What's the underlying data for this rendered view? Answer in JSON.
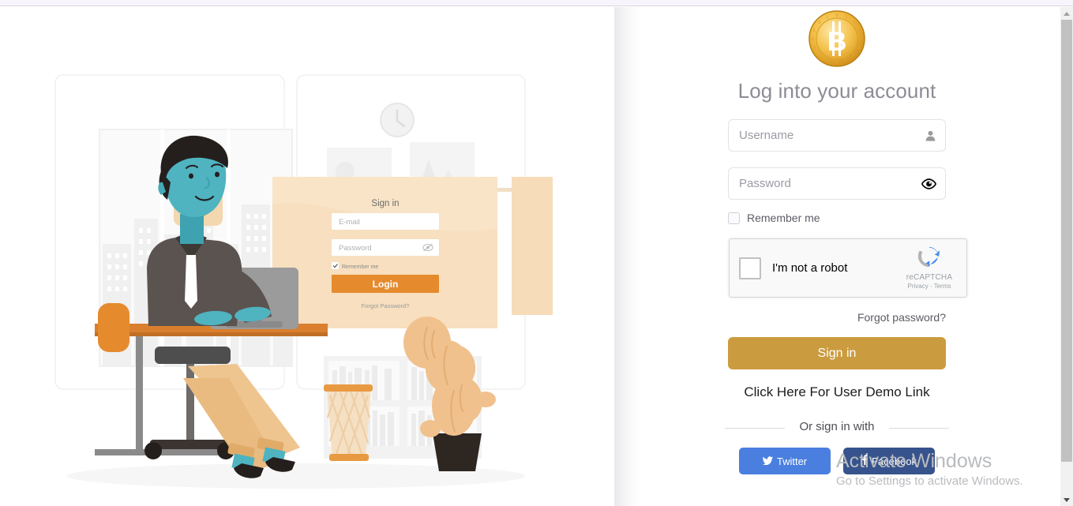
{
  "page": {
    "title": "Log into your account",
    "logo_icon": "bitcoin-coin-icon",
    "logo_symbol": "Ƀ"
  },
  "form": {
    "username": {
      "value": "",
      "placeholder": "Username",
      "icon": "user-icon"
    },
    "password": {
      "value": "",
      "placeholder": "Password",
      "icon": "eye-icon"
    },
    "remember_me_label": "Remember me",
    "remember_me_checked": false,
    "forgot_password_label": "Forgot password?",
    "signin_label": "Sign in",
    "demo_link_label": "Click Here For User Demo Link",
    "or_divider_label": "Or sign in with"
  },
  "recaptcha": {
    "label": "I'm not a robot",
    "brand": "reCAPTCHA",
    "legal": "Privacy - Terms",
    "checked": false,
    "icon": "recaptcha-icon"
  },
  "social": [
    {
      "label": "Twitter",
      "icon": "twitter-icon",
      "color": "#4a7fe0",
      "name": "twitter-button"
    },
    {
      "label": "Facebook",
      "icon": "facebook-icon",
      "color": "#37538d",
      "name": "facebook-button"
    }
  ],
  "illustration": {
    "alt_name": "login-illustration",
    "mock_form": {
      "heading": "Sign in",
      "email_placeholder": "E-mail",
      "password_placeholder": "Password",
      "remember_label": "Remember me",
      "login_button": "Login",
      "forgot_label": "Forgot Password?"
    }
  },
  "watermark": {
    "title": "Activate Windows",
    "subtitle": "Go to Settings to activate Windows."
  },
  "colors": {
    "accent_gold": "#cb9c3f",
    "illustration_orange": "#e58b2e",
    "illustration_peach": "#f4d6b0",
    "illustration_teal": "#4fb3c0",
    "twitter_blue": "#4a7fe0",
    "facebook_blue": "#37538d"
  },
  "scrollbar": {
    "up_icon": "chevron-up-icon",
    "down_icon": "chevron-down-icon"
  }
}
